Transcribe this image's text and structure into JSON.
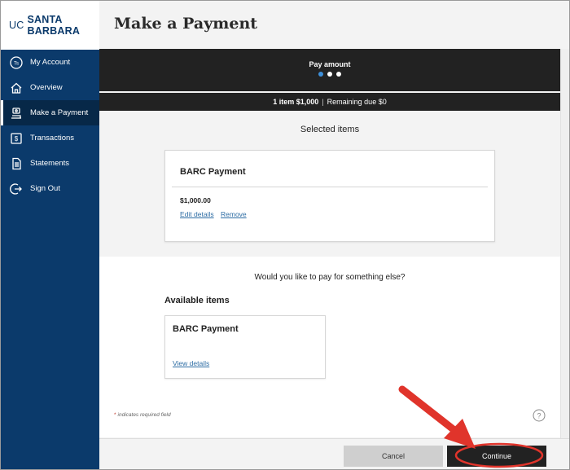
{
  "logo": {
    "uc": "UC",
    "sb": "SANTA BARBARA"
  },
  "sidebar": {
    "items": [
      {
        "label": "My Account",
        "icon": "ts-badge-icon"
      },
      {
        "label": "Overview",
        "icon": "home-icon"
      },
      {
        "label": "Make a Payment",
        "icon": "payment-icon",
        "active": true
      },
      {
        "label": "Transactions",
        "icon": "dollar-receipt-icon"
      },
      {
        "label": "Statements",
        "icon": "document-icon"
      },
      {
        "label": "Sign Out",
        "icon": "sign-out-icon"
      }
    ]
  },
  "page": {
    "title": "Make a Payment"
  },
  "header": {
    "step": "Pay amount",
    "summary_items": "1 item $1,000",
    "summary_sep": "|",
    "summary_remaining": "Remaining due $0"
  },
  "selected": {
    "title": "Selected items",
    "item_name": "BARC Payment",
    "amount": "$1,000.00",
    "edit_label": "Edit details",
    "remove_label": "Remove"
  },
  "available": {
    "question": "Would you like to pay for something else?",
    "title": "Available items",
    "item_name": "BARC Payment",
    "view_label": "View details"
  },
  "footer": {
    "required_star": "*",
    "required_text": "indicates required field",
    "cancel_label": "Cancel",
    "continue_label": "Continue"
  },
  "colors": {
    "sidebar": "#0b3a6b",
    "header": "#222222",
    "accent_dot": "#3d8fd9",
    "link": "#2e6da4",
    "annotation": "#e0342b"
  }
}
